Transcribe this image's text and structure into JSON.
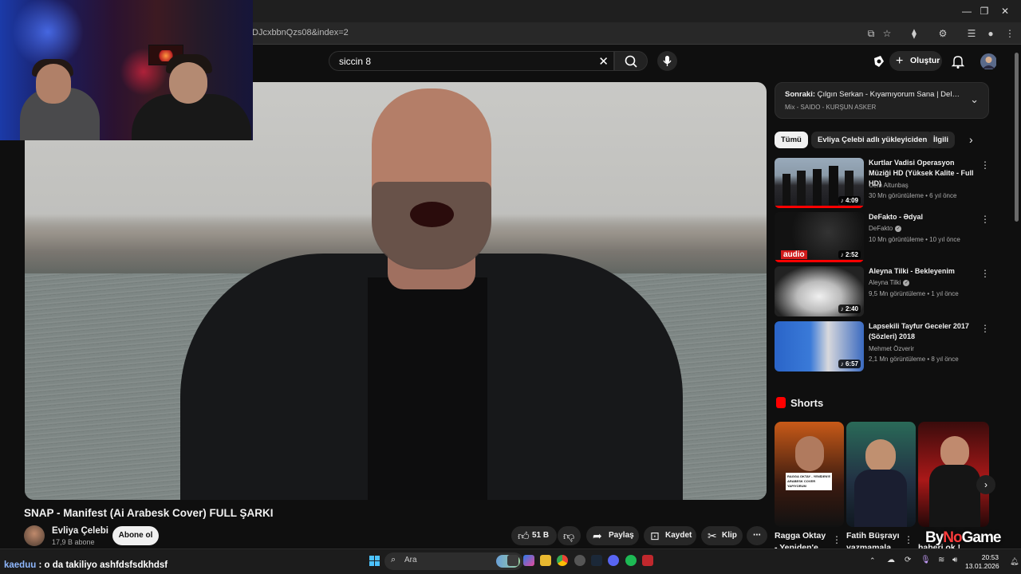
{
  "browser": {
    "url": "DJcxbbnQzs08&index=2"
  },
  "header": {
    "search_value": "siccin 8",
    "create_label": "Oluştur"
  },
  "video": {
    "title": "SNAP - Manifest (Ai Arabesk Cover) FULL ŞARKI",
    "channel_name": "Evliya Çelebi",
    "subscribers": "17,9 B abone",
    "subscribe_label": "Abone ol",
    "likes": "51 B",
    "share_label": "Paylaş",
    "save_label": "Kaydet",
    "clip_label": "Klip"
  },
  "up_next": {
    "prefix": "Sonraki:",
    "title": "Çılgın Serkan - Kıyamıyorum Sana | Deliviz...",
    "subtitle": "Mix - SAIDO - KURŞUN ASKER"
  },
  "chips": [
    "Tümü",
    "Evliya Çelebi adlı yükleyiciden",
    "İlgili"
  ],
  "recommendations": [
    {
      "title": "Kurtlar Vadisi Operasyon Müziği HD (Yüksek Kalite - Full HD)",
      "channel": "Cem Altunbaş",
      "meta": "30 Mn görüntüleme • 6 yıl önce",
      "duration": "4:09",
      "verified": false
    },
    {
      "title": "DeFakto - Ədyal",
      "channel": "DeFakto",
      "meta": "10 Mn görüntüleme • 10 yıl önce",
      "duration": "2:52",
      "verified": true,
      "thumb_text": "audio"
    },
    {
      "title": "Aleyna Tilki - Bekleyenim",
      "channel": "Aleyna Tilki",
      "meta": "9,5 Mn görüntüleme • 1 yıl önce",
      "duration": "2:40",
      "verified": true
    },
    {
      "title": "Lapsekili Tayfur Geceler 2017 (Sözleri) 2018",
      "channel": "Mehmet Özverir",
      "meta": "2,1 Mn görüntüleme • 8 yıl önce",
      "duration": "6:57",
      "verified": false
    }
  ],
  "shorts": {
    "heading": "Shorts",
    "items": [
      {
        "caption": "Ragga Oktay",
        "caption2": "- Yeniden'e",
        "thumb_text": "RAGGA OKTAY - YENİDEN'E ARABESK COVER YAPIYORUM"
      },
      {
        "caption": "Fatih Büşrayı",
        "caption2": "yazmamala"
      },
      {
        "caption": "",
        "caption2": "haberi ok !"
      }
    ]
  },
  "taskbar": {
    "search_label": "Ara",
    "time": "20:53",
    "date": "13.01.2026"
  },
  "chat": {
    "user": "kaeduu",
    "message": ": o da takiliyo ashfdsfsdkhdsf"
  },
  "watermark": {
    "part1": "By",
    "part2": "No",
    "part3": "Game"
  },
  "colors": {
    "background": "#0f0f0f",
    "accent_red": "#ff0000",
    "text_primary": "#f1f1f1",
    "text_secondary": "#aaaaaa"
  }
}
